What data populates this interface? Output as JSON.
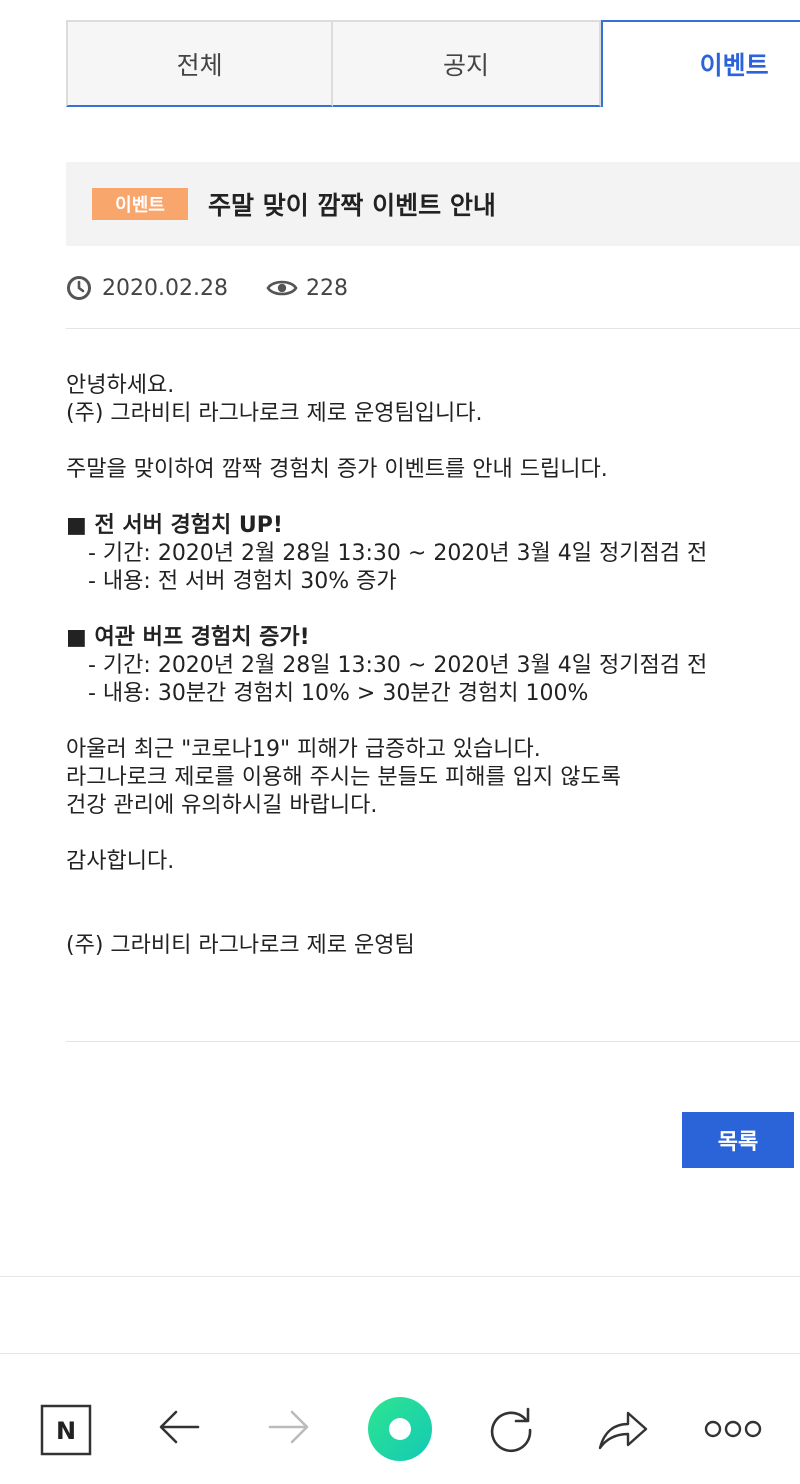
{
  "tabs": [
    {
      "label": "전체"
    },
    {
      "label": "공지"
    },
    {
      "label": "이벤트"
    }
  ],
  "post": {
    "badge": "이벤트",
    "title": "주말 맞이 깜짝 이벤트 안내",
    "date": "2020.02.28",
    "views": "228"
  },
  "content": {
    "lines": [
      "안녕하세요.",
      "(주) 그라비티 라그나로크 제로 운영팀입니다.",
      "주말을 맞이하여 깜짝 경험치 증가 이벤트를 안내 드립니다.",
      "■ 전 서버 경험치 UP!",
      "- 기간: 2020년 2월 28일 13:30 ~ 2020년 3월 4일 정기점검 전",
      "- 내용: 전 서버 경험치 30% 증가",
      "■ 여관 버프 경험치 증가!",
      "- 기간: 2020년 2월 28일 13:30 ~ 2020년 3월 4일 정기점검 전",
      "- 내용: 30분간 경험치 10% > 30분간 경험치 100%",
      "아울러 최근 \"코로나19\" 피해가 급증하고 있습니다.",
      "라그나로크 제로를 이용해 주시는 분들도 피해를 입지 않도록",
      "건강 관리에 유의하시길 바랍니다.",
      "감사합니다.",
      "(주) 그라비티 라그나로크 제로 운영팀"
    ]
  },
  "buttons": {
    "list_label": "목록"
  },
  "bottom_bar": {
    "icons": [
      "naver-home-icon",
      "back-arrow-icon",
      "forward-arrow-icon",
      "green-home-icon",
      "refresh-icon",
      "share-icon",
      "more-icon"
    ],
    "naver_letter": "N"
  },
  "colors": {
    "accent": "#2b63d9",
    "badge": "#f9a66c",
    "title_bg": "#f3f3f3"
  }
}
